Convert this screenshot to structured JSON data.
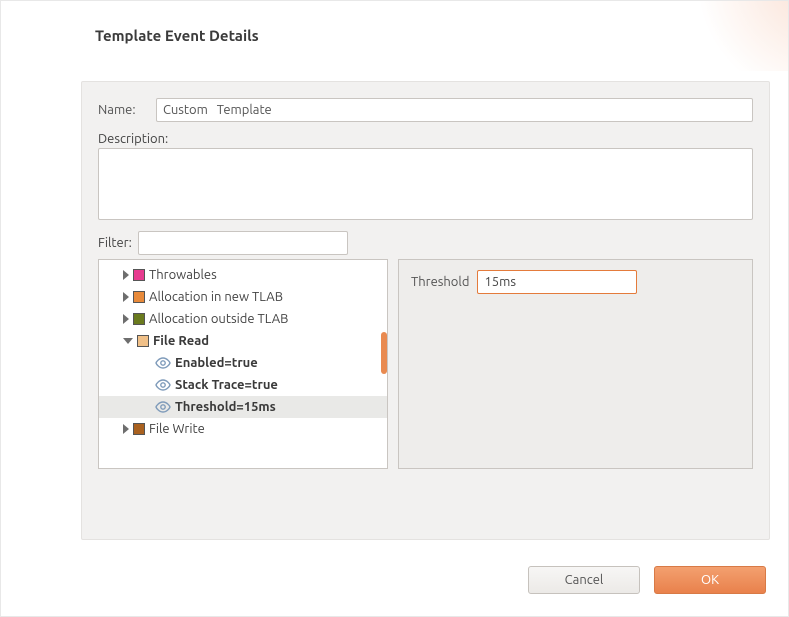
{
  "header": {
    "title": "Template Event Details"
  },
  "form": {
    "name_label": "Name:",
    "name_value": "Custom   Template",
    "desc_label": "Description:",
    "desc_value": "",
    "filter_label": "Filter:",
    "filter_value": ""
  },
  "tree": [
    {
      "label": "Throwables",
      "kind": "cat",
      "expanded": false,
      "bold": false,
      "color": "#e73b8f",
      "indent": 1
    },
    {
      "label": "Allocation in new TLAB",
      "kind": "cat",
      "expanded": false,
      "bold": false,
      "color": "#e88a3a",
      "indent": 1
    },
    {
      "label": "Allocation outside TLAB",
      "kind": "cat",
      "expanded": false,
      "bold": false,
      "color": "#6a7a1e",
      "indent": 1
    },
    {
      "label": "File Read",
      "kind": "cat",
      "expanded": true,
      "bold": true,
      "color": "#f0c088",
      "indent": 1
    },
    {
      "label": "Enabled=true",
      "kind": "prop",
      "bold": true,
      "indent": 2
    },
    {
      "label": "Stack Trace=true",
      "kind": "prop",
      "bold": true,
      "indent": 2
    },
    {
      "label": "Threshold=15ms",
      "kind": "prop",
      "bold": true,
      "indent": 2,
      "selected": true
    },
    {
      "label": "File Write",
      "kind": "cat",
      "expanded": false,
      "bold": false,
      "color": "#a9611f",
      "indent": 1
    }
  ],
  "threshold_panel": {
    "label": "Threshold",
    "value": "15ms"
  },
  "buttons": {
    "cancel": "Cancel",
    "ok": "OK"
  },
  "icons": {
    "eye": "eye-icon"
  }
}
